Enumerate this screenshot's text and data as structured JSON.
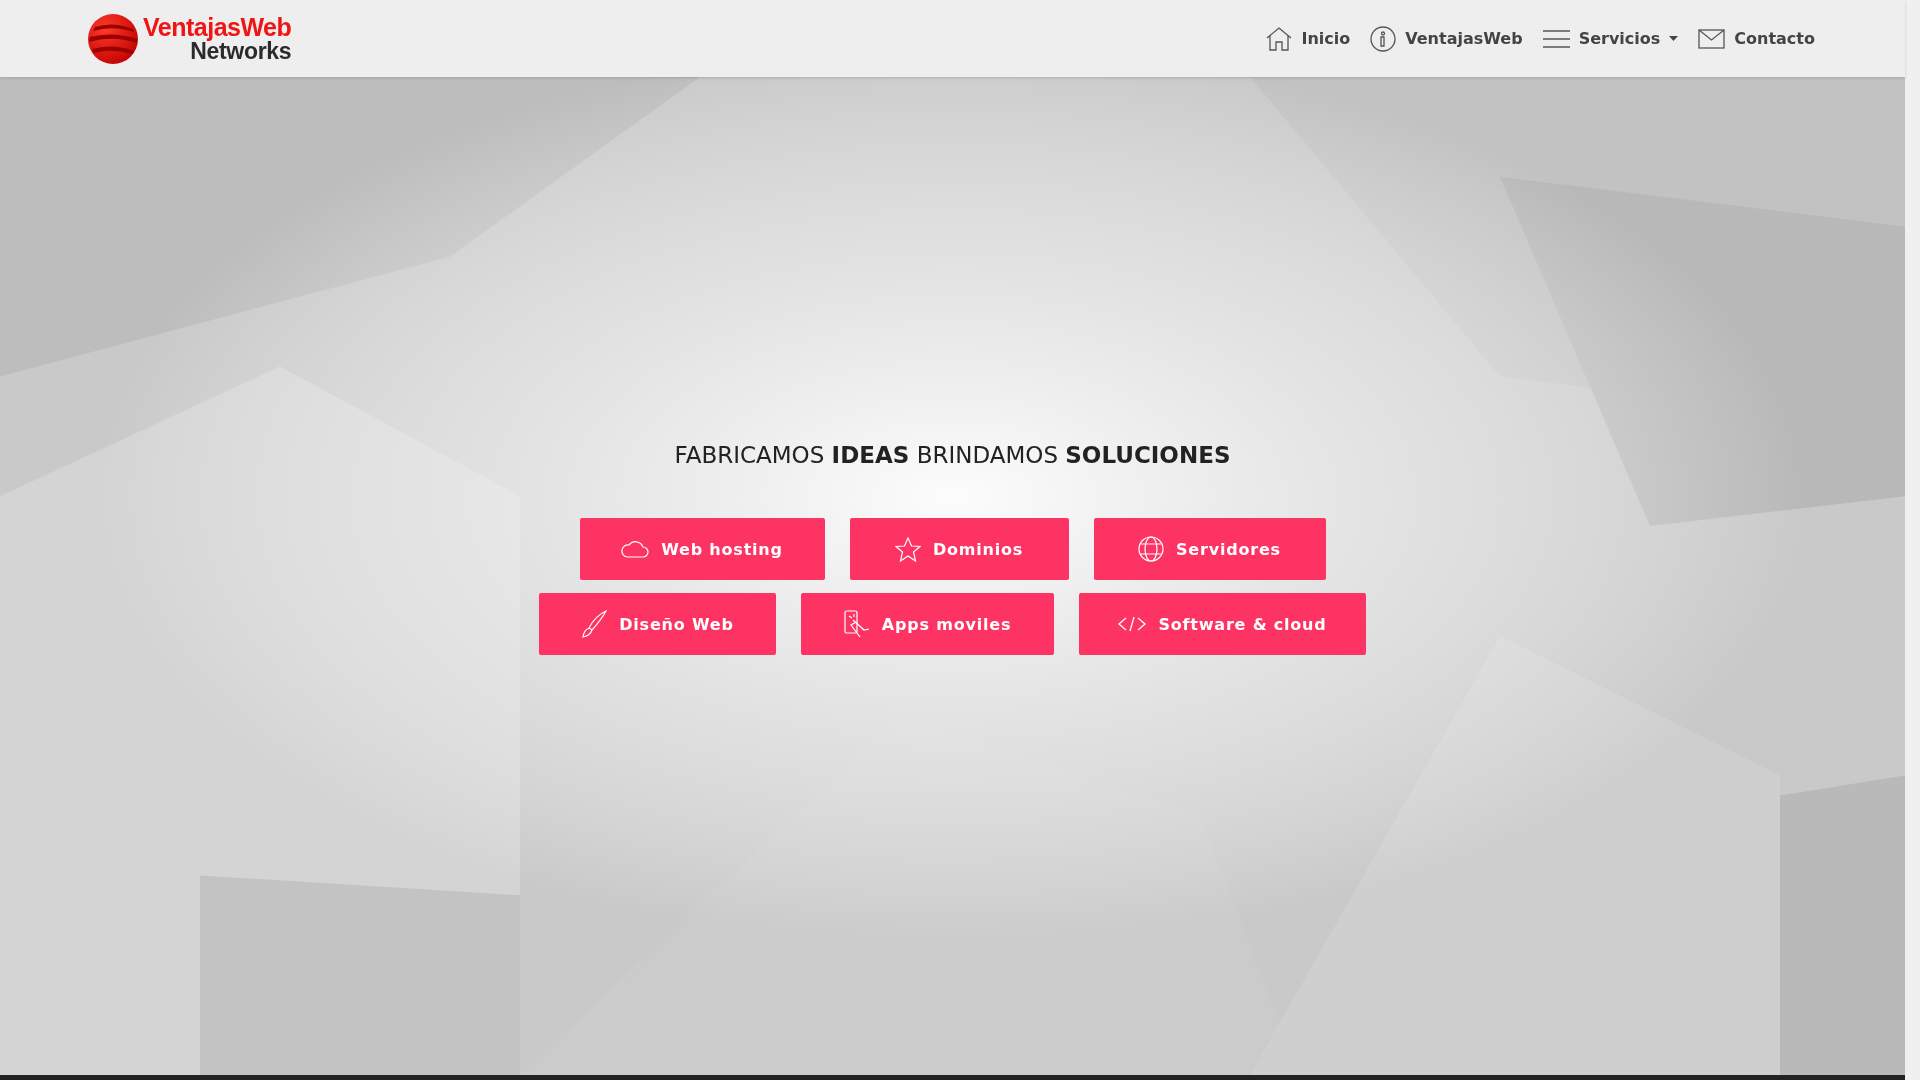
{
  "logo": {
    "line_1": "VentajasWeb",
    "line_2": "Networks"
  },
  "nav": [
    {
      "label": "Inicio",
      "has_menu": false
    },
    {
      "label": "VentajasWeb",
      "has_menu": false
    },
    {
      "label": "Servicios",
      "has_menu": true
    },
    {
      "label": "Contacto",
      "has_menu": false
    }
  ],
  "hero": {
    "kind": "picture",
    "headline": "FABRICAMOS **IDEAS** BRINDAMOS **SOLUCIONES**",
    "button_rows": [
      [
        {
          "label": "Web hosting"
        },
        {
          "label": "Dominios"
        },
        {
          "label": "Servidores"
        }
      ],
      [
        {
          "label": "Diseño Web"
        },
        {
          "label": "Apps moviles"
        },
        {
          "label": "Software & cloud"
        }
      ]
    ]
  }
}
